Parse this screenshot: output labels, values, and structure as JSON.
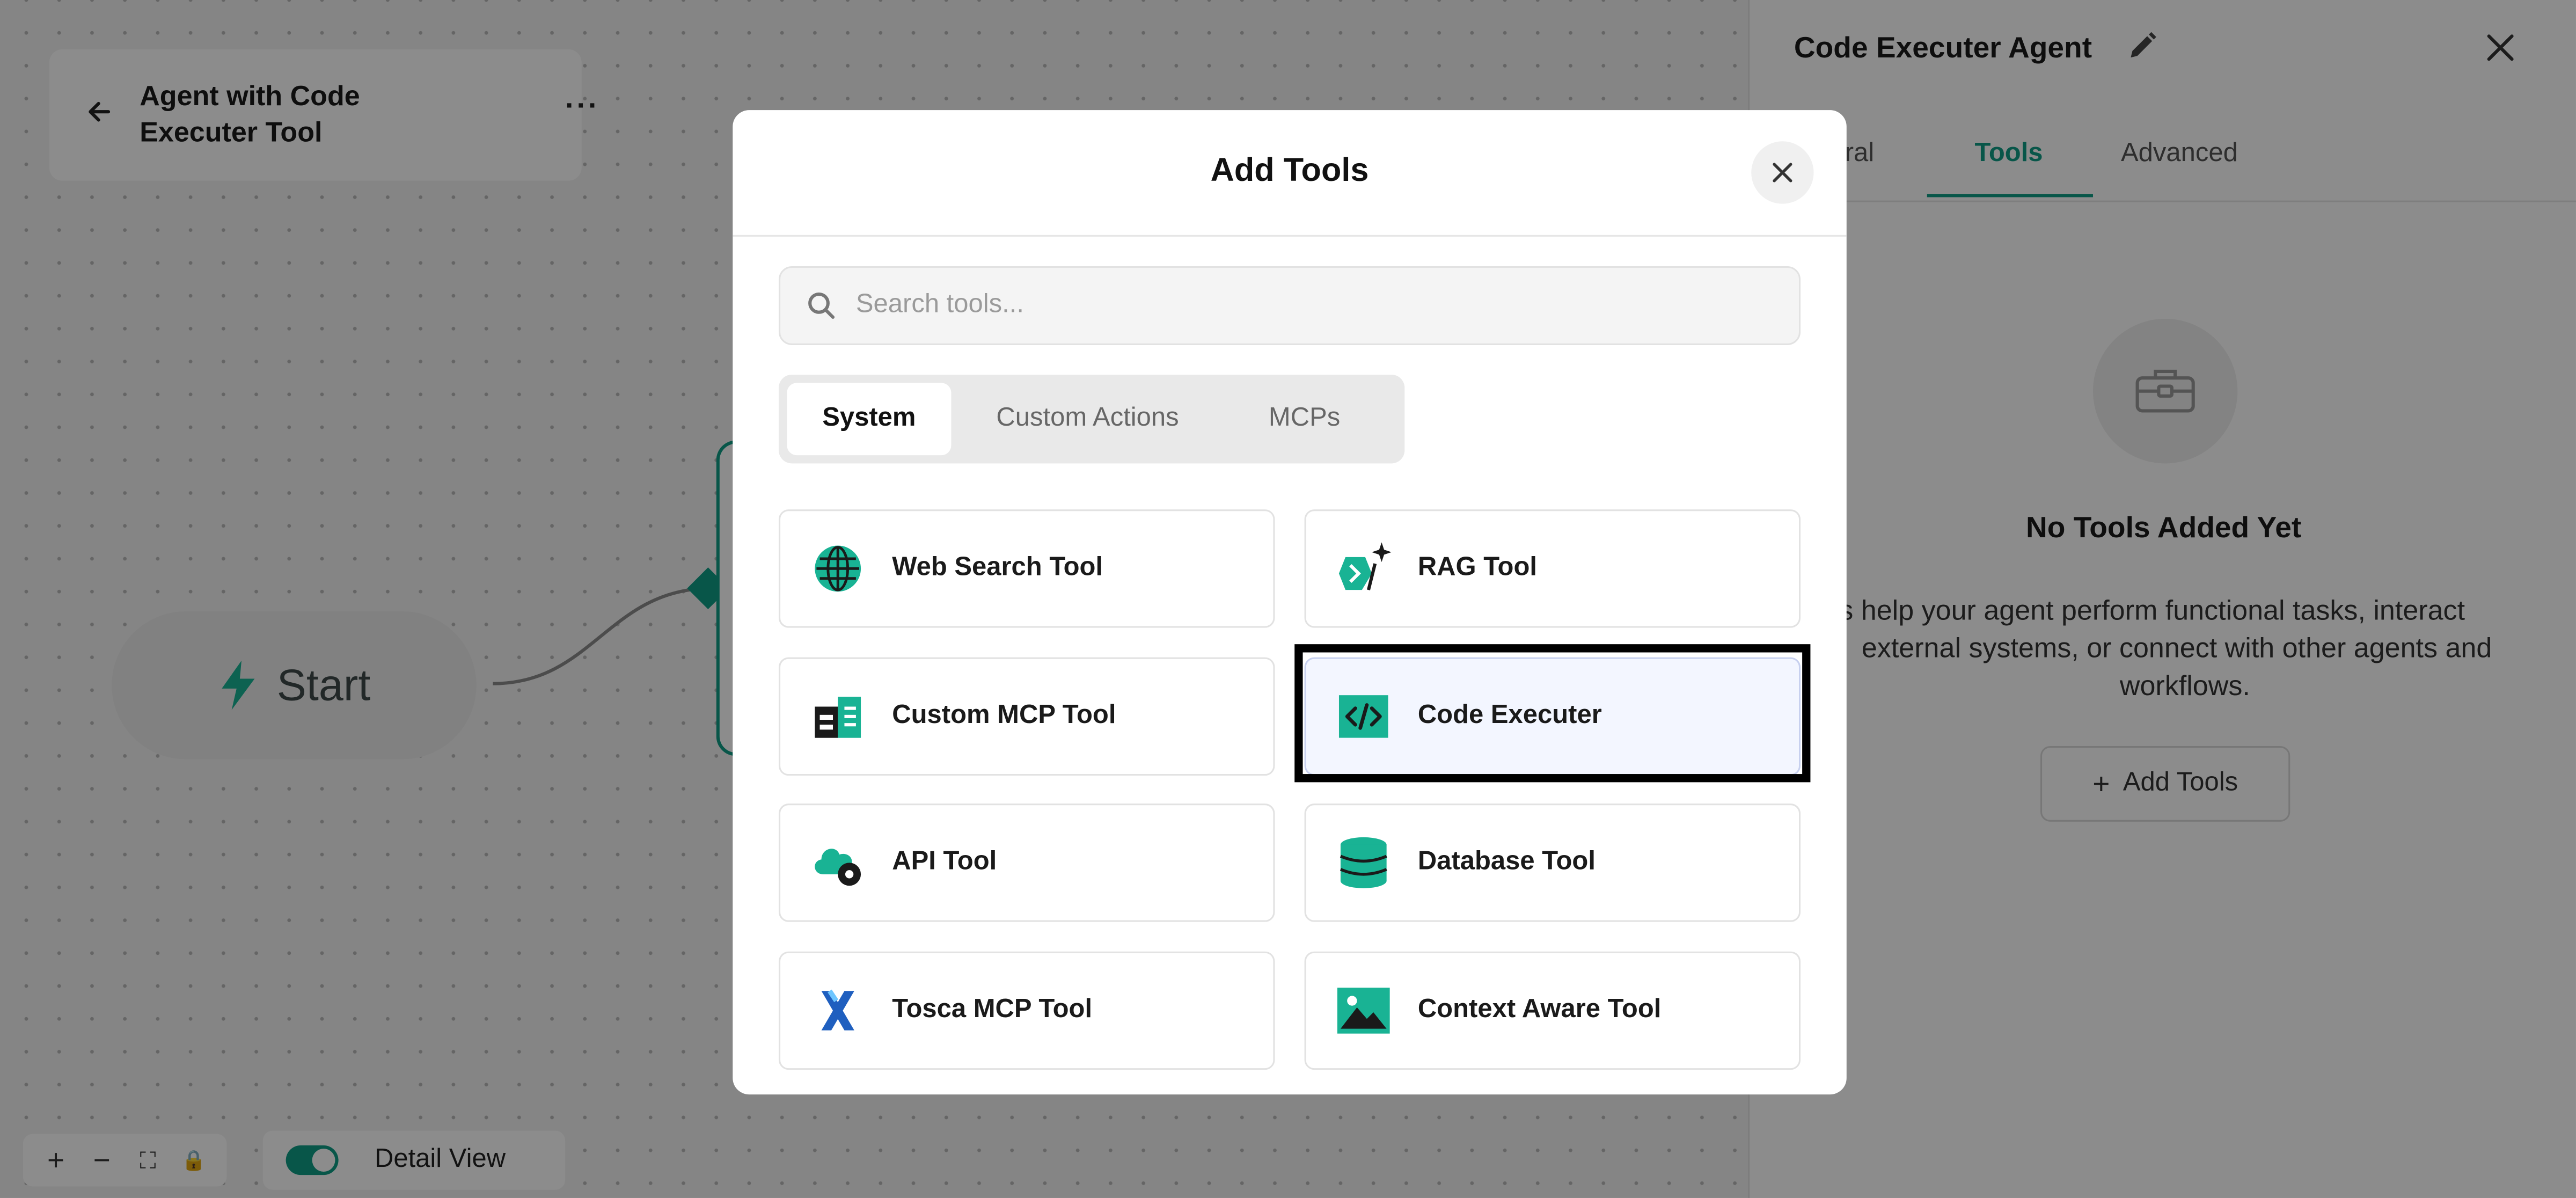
{
  "canvas": {
    "workflow_title": "Agent with Code Executer Tool",
    "more_label": "···",
    "start_label": "Start",
    "detail_view_label": "Detail View",
    "controls": [
      "+",
      "−",
      "⛶",
      "🔒"
    ]
  },
  "panel": {
    "title": "Code Executer Agent",
    "tabs": [
      {
        "label": "ral"
      },
      {
        "label": "Tools"
      },
      {
        "label": "Advanced"
      }
    ],
    "empty_title": "No Tools Added Yet",
    "empty_desc_line1": "s help your agent perform functional tasks, interact",
    "empty_desc_line2": "external systems, or connect with other agents and",
    "empty_desc_line3": "workflows.",
    "add_tools_label": "Add Tools"
  },
  "modal": {
    "title": "Add Tools",
    "search_placeholder": "Search tools...",
    "segments": [
      {
        "label": "System"
      },
      {
        "label": "Custom Actions"
      },
      {
        "label": "MCPs"
      }
    ],
    "tools": [
      {
        "label": "Web Search Tool",
        "icon": "globe-icon"
      },
      {
        "label": "RAG Tool",
        "icon": "rag-icon"
      },
      {
        "label": "Custom MCP Tool",
        "icon": "custom-mcp-icon"
      },
      {
        "label": "Code Executer",
        "icon": "code-icon"
      },
      {
        "label": "API Tool",
        "icon": "cloud-gear-icon"
      },
      {
        "label": "Database Tool",
        "icon": "database-icon"
      },
      {
        "label": "Tosca MCP Tool",
        "icon": "tosca-icon"
      },
      {
        "label": "Context Aware Tool",
        "icon": "image-icon"
      }
    ]
  },
  "colors": {
    "accent": "#0f9d86",
    "tool_icon_green": "#19b394",
    "tosca_blue": "#1f5fbf"
  }
}
